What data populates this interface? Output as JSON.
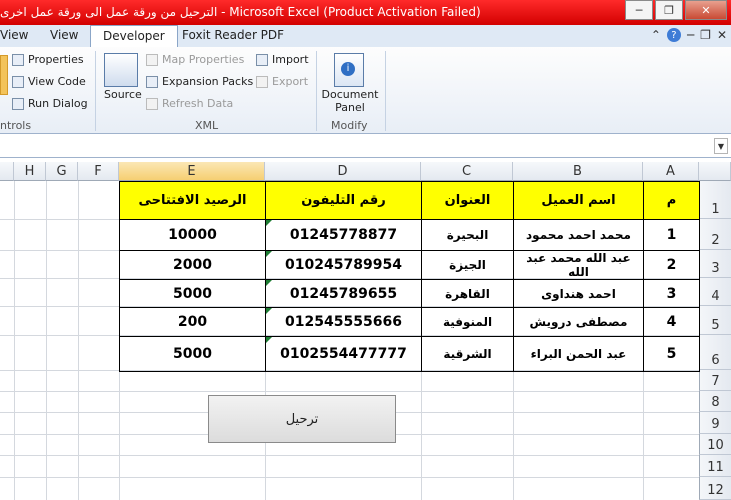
{
  "window": {
    "title": "الترحيل من ورقة عمل الى ورقة عمل اخرى  -  Microsoft Excel (Product Activation Failed)",
    "controls": {
      "minimize": "─",
      "restore": "❐",
      "close": "✕"
    }
  },
  "tabs": [
    "View",
    "View",
    "Developer",
    "Foxit Reader PDF"
  ],
  "ribbon": {
    "controls_group": {
      "properties": "Properties",
      "view_code": "View Code",
      "run_dialog": "Run Dialog",
      "label": "ntrols"
    },
    "xml_group": {
      "source": "Source",
      "map_properties": "Map Properties",
      "expansion_packs": "Expansion Packs",
      "refresh_data": "Refresh Data",
      "import": "Import",
      "export": "Export",
      "label": "XML"
    },
    "modify_group": {
      "document_panel": "Document Panel",
      "label": "Modify"
    }
  },
  "columns": [
    "H",
    "G",
    "F",
    "E",
    "D",
    "C",
    "B",
    "A"
  ],
  "rows": [
    "1",
    "2",
    "3",
    "4",
    "5",
    "6",
    "7",
    "8",
    "9",
    "10",
    "11",
    "12"
  ],
  "table": {
    "headers": [
      "الرصيد الافتتاحى",
      "رقم التليفون",
      "العنوان",
      "اسم العميل",
      "م"
    ],
    "rows": [
      [
        "10000",
        "01245778877",
        "البحيرة",
        "محمد احمد محمود",
        "1"
      ],
      [
        "2000",
        "010245789954",
        "الجيزة",
        "عبد الله محمد عبد الله",
        "2"
      ],
      [
        "5000",
        "01245789655",
        "القاهرة",
        "احمد هنداوى",
        "3"
      ],
      [
        "200",
        "012545555666",
        "المنوفية",
        "مصطفى درويش",
        "4"
      ],
      [
        "5000",
        "0102554477777",
        "الشرقية",
        "عبد الحمن البراء",
        "5"
      ]
    ]
  },
  "button": {
    "label": "ترحيل"
  },
  "colors": {
    "header_fill": "#ffff00",
    "title_bar": "#e00000",
    "selected_column": "#f6cf72"
  }
}
